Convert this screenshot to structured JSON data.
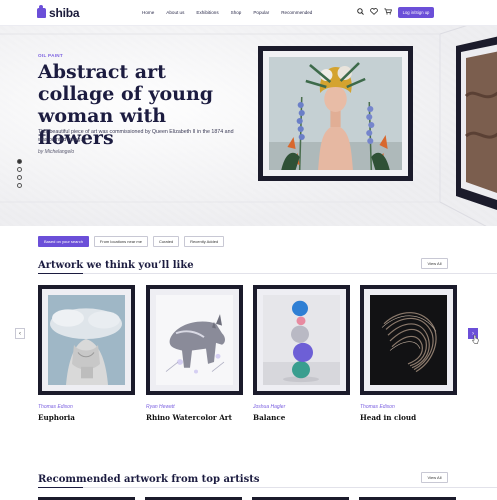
{
  "brand": {
    "name": "shiba",
    "accent": "#6b4fd8"
  },
  "nav": {
    "items": [
      "Home",
      "About us",
      "Exhibitions",
      "Shop",
      "Popular",
      "Recommended"
    ]
  },
  "header": {
    "login_label": "Log in/Sign up",
    "icons": [
      "search-icon",
      "heart-icon",
      "cart-icon"
    ]
  },
  "hero": {
    "kicker": "OIL PAINT",
    "title": "Abstract art collage of young woman with flowers",
    "description": "This beautiful piece of art was commissioned by Queen Elizabeth II in the 1874 and was painted using…",
    "byline": "by Michelangelo",
    "slide_count": 4,
    "active_slide": 1
  },
  "filters": {
    "chips": [
      "Based on your search",
      "From locations near me",
      "Curated",
      "Recently Added"
    ],
    "active": 0
  },
  "section1": {
    "title": "Artwork we think you’ll like",
    "view_all": "View All"
  },
  "artworks": [
    {
      "artist": "Thomas Edison",
      "name": "Euphoria"
    },
    {
      "artist": "Ryan Hewett",
      "name": "Rhino Watercolor Art"
    },
    {
      "artist": "Joshua Hagler",
      "name": "Balance"
    },
    {
      "artist": "Thomas Edison",
      "name": "Head in cloud"
    }
  ],
  "carousel": {
    "prev": "‹",
    "next": "›"
  },
  "section2": {
    "title": "Recommended artwork from top artists",
    "view_all": "View All"
  }
}
